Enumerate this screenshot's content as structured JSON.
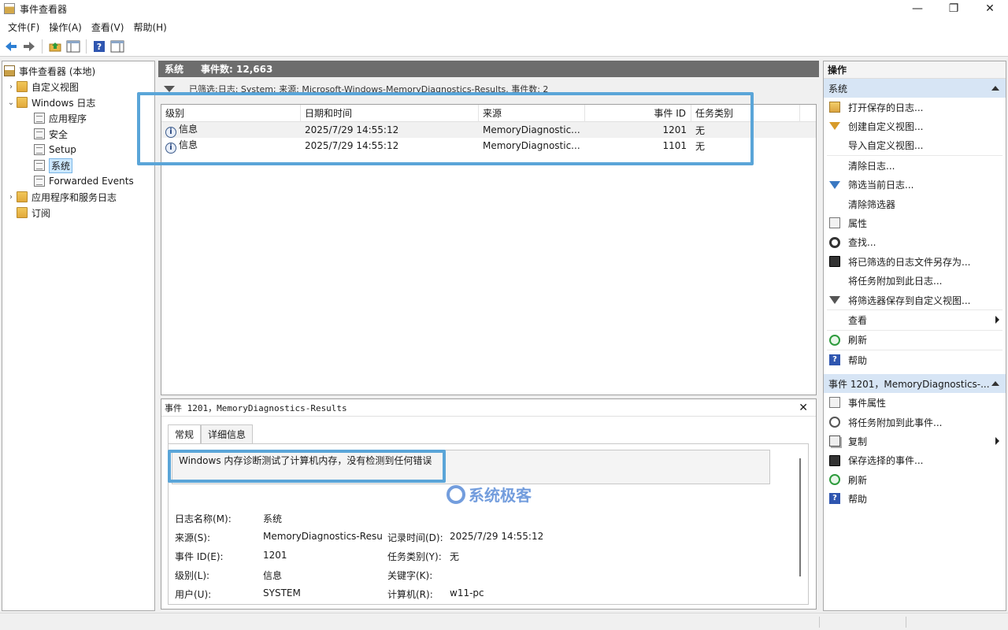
{
  "window": {
    "title": "事件查看器",
    "minimize": "—",
    "maximize": "❐",
    "close": "✕"
  },
  "menu": [
    "文件(F)",
    "操作(A)",
    "查看(V)",
    "帮助(H)"
  ],
  "tree": [
    {
      "label": "事件查看器 (本地)",
      "icon": "event-viewer-icon",
      "level": 0,
      "chevron": ""
    },
    {
      "label": "自定义视图",
      "icon": "folder-icon",
      "level": 1,
      "chevron": "›"
    },
    {
      "label": "Windows 日志",
      "icon": "folder-icon",
      "level": 1,
      "chevron": "⌄"
    },
    {
      "label": "应用程序",
      "icon": "log-icon",
      "level": 2,
      "chevron": ""
    },
    {
      "label": "安全",
      "icon": "log-icon",
      "level": 2,
      "chevron": ""
    },
    {
      "label": "Setup",
      "icon": "log-icon",
      "level": 2,
      "chevron": ""
    },
    {
      "label": "系统",
      "icon": "log-icon",
      "level": 2,
      "chevron": "",
      "selected": true
    },
    {
      "label": "Forwarded Events",
      "icon": "log-icon",
      "level": 2,
      "chevron": ""
    },
    {
      "label": "应用程序和服务日志",
      "icon": "folder-icon",
      "level": 1,
      "chevron": "›"
    },
    {
      "label": "订阅",
      "icon": "folder-icon",
      "level": 1,
      "chevron": ""
    }
  ],
  "center": {
    "header_name": "系统",
    "header_count": "事件数: 12,663",
    "filter_text": "已筛选:日志: System; 来源: Microsoft-Windows-MemoryDiagnostics-Results. 事件数: 2",
    "columns": [
      "级别",
      "日期和时间",
      "来源",
      "事件 ID",
      "任务类别"
    ],
    "rows": [
      [
        "信息",
        "2025/7/29 14:55:12",
        "MemoryDiagnostic...",
        "1201",
        "无"
      ],
      [
        "信息",
        "2025/7/29 14:55:12",
        "MemoryDiagnostic...",
        "1101",
        "无"
      ]
    ]
  },
  "detail": {
    "title": "事件 1201，MemoryDiagnostics-Results",
    "close": "✕",
    "tabs": [
      "常规",
      "详细信息"
    ],
    "description": "Windows 内存诊断测试了计算机内存，没有检测到任何错误",
    "log_name_label": "日志名称(M):",
    "log_name_value": "系统",
    "source_label": "来源(S):",
    "source_value": "MemoryDiagnostics-Resu",
    "logged_label": "记录时间(D):",
    "logged_value": "2025/7/29 14:55:12",
    "event_id_label": "事件 ID(E):",
    "event_id_value": "1201",
    "task_label": "任务类别(Y):",
    "task_value": "无",
    "level_label": "级别(L):",
    "level_value": "信息",
    "keywords_label": "关键字(K):",
    "keywords_value": "",
    "user_label": "用户(U):",
    "user_value": "SYSTEM",
    "computer_label": "计算机(R):",
    "computer_value": "w11-pc"
  },
  "watermark": "系统极客",
  "actions": {
    "header": "操作",
    "group1": "系统",
    "items1": [
      {
        "label": "打开保存的日志...",
        "icon": "open-log-icon"
      },
      {
        "label": "创建自定义视图...",
        "icon": "create-view-icon"
      },
      {
        "label": "导入自定义视图...",
        "icon": ""
      },
      {
        "label": "清除日志...",
        "icon": ""
      },
      {
        "label": "筛选当前日志...",
        "icon": "filter-icon"
      },
      {
        "label": "清除筛选器",
        "icon": ""
      },
      {
        "label": "属性",
        "icon": "properties-icon"
      },
      {
        "label": "查找...",
        "icon": "find-icon"
      },
      {
        "label": "将已筛选的日志文件另存为...",
        "icon": "save-icon"
      },
      {
        "label": "将任务附加到此日志...",
        "icon": ""
      },
      {
        "label": "将筛选器保存到自定义视图...",
        "icon": "save-filter-icon"
      },
      {
        "label": "查看",
        "icon": "",
        "submenu": true
      },
      {
        "label": "刷新",
        "icon": "refresh-icon"
      },
      {
        "label": "帮助",
        "icon": "help-icon"
      }
    ],
    "group2": "事件 1201，MemoryDiagnostics-...",
    "items2": [
      {
        "label": "事件属性",
        "icon": "event-properties-icon"
      },
      {
        "label": "将任务附加到此事件...",
        "icon": "attach-task-icon"
      },
      {
        "label": "复制",
        "icon": "copy-icon",
        "submenu": true
      },
      {
        "label": "保存选择的事件...",
        "icon": "save-icon"
      },
      {
        "label": "刷新",
        "icon": "refresh-icon"
      },
      {
        "label": "帮助",
        "icon": "help-icon"
      }
    ]
  },
  "colors": {
    "highlight": "#5aa5d8",
    "selection": "#cce8ff",
    "header_bg": "#6d6d6d",
    "group_bg": "#d7e5f5"
  }
}
